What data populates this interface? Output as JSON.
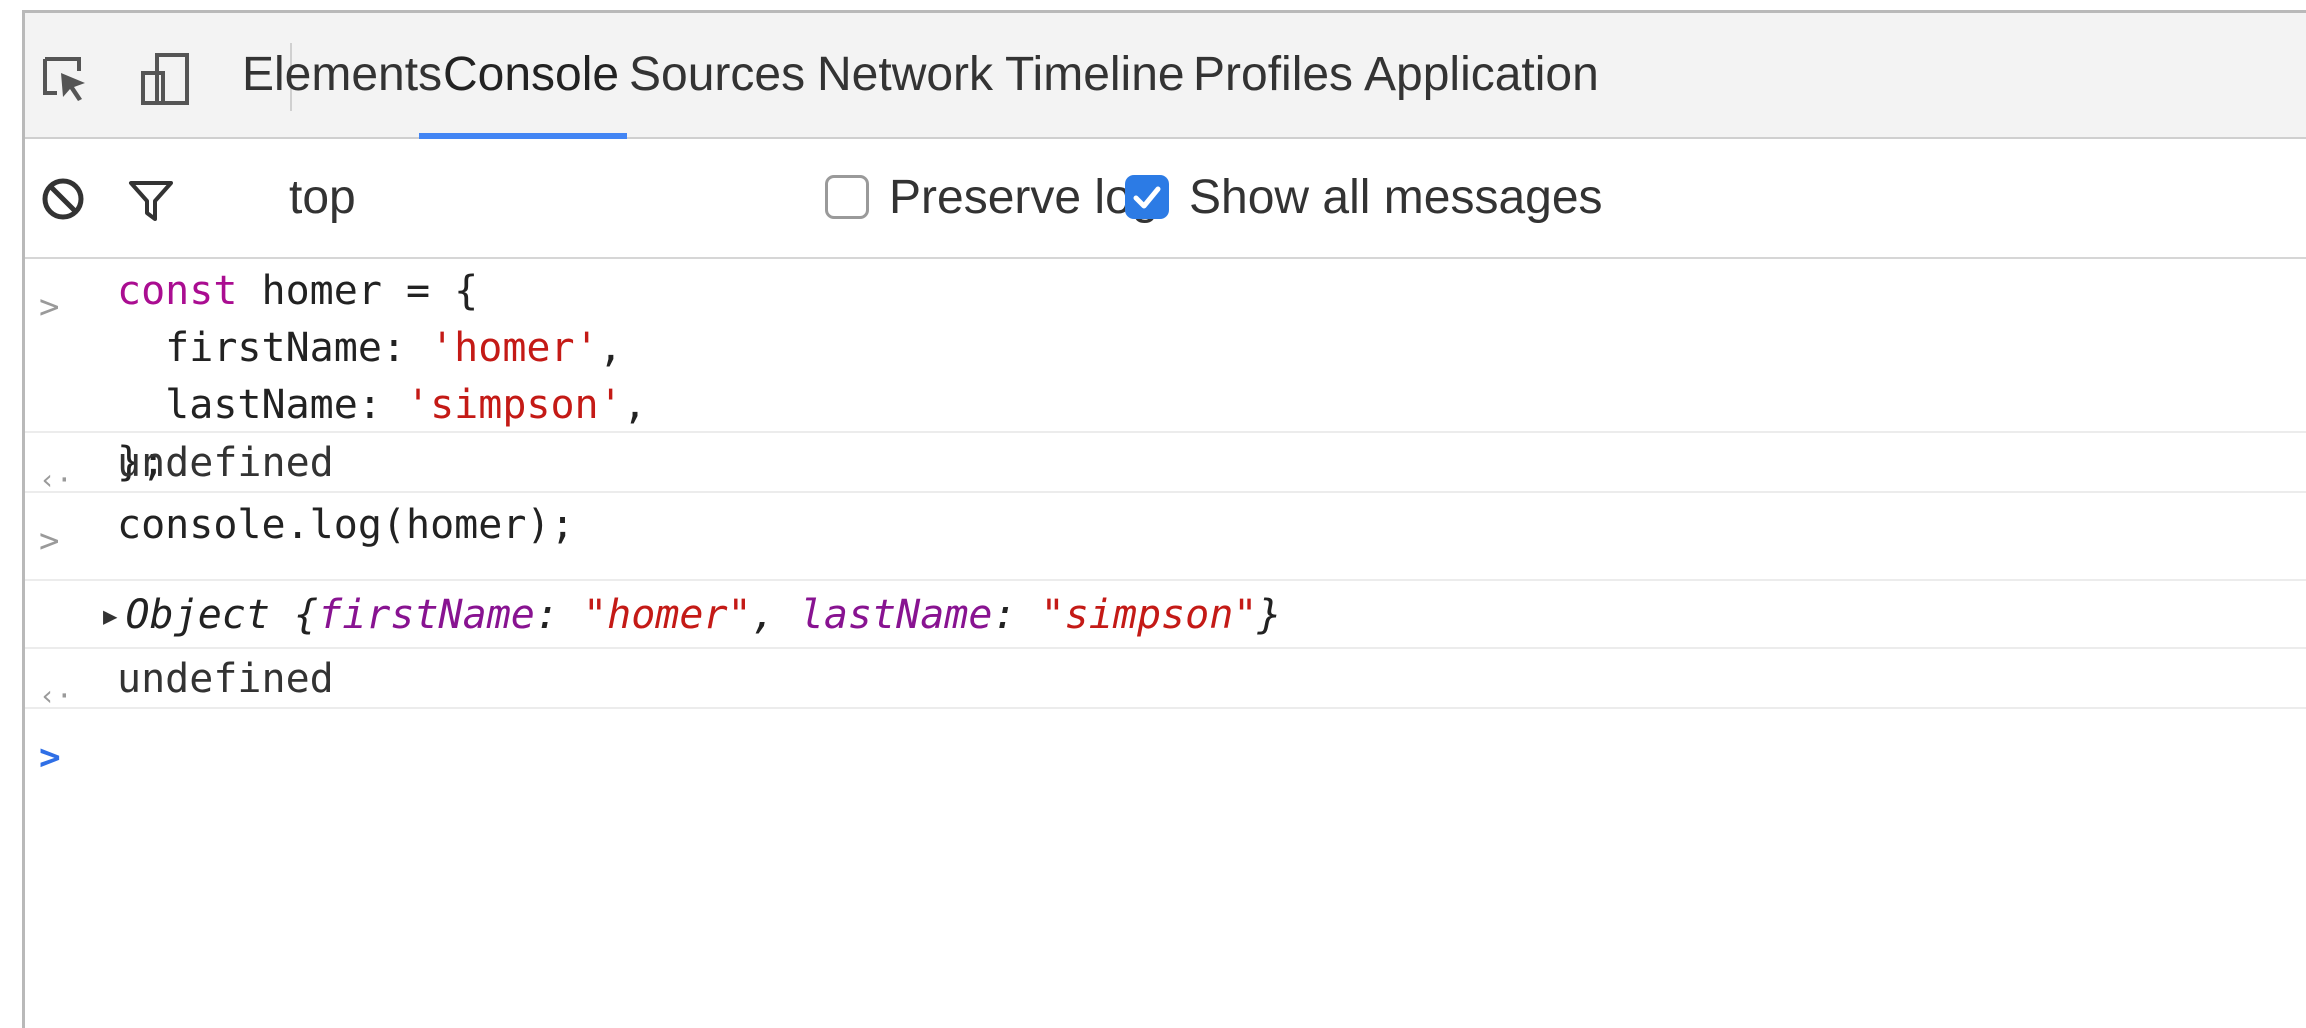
{
  "toolbar_tabs": {
    "tabs": [
      "Elements",
      "Console",
      "Sources",
      "Network",
      "Timeline",
      "Profiles",
      "Application"
    ],
    "active_tab": "Console"
  },
  "console_toolbar": {
    "context": "top",
    "preserve_log_label": "Preserve log",
    "preserve_log_checked": false,
    "show_all_label": "Show all messages",
    "show_all_checked": true
  },
  "console": {
    "entries": [
      {
        "type": "input",
        "lines": [
          {
            "parts": [
              {
                "t": "const",
                "c": "kw"
              },
              {
                "t": " homer = {",
                "c": ""
              }
            ]
          },
          {
            "parts": [
              {
                "t": "  firstName: ",
                "c": ""
              },
              {
                "t": "'homer'",
                "c": "str"
              },
              {
                "t": ",",
                "c": ""
              }
            ]
          },
          {
            "parts": [
              {
                "t": "  lastName: ",
                "c": ""
              },
              {
                "t": "'simpson'",
                "c": "str"
              },
              {
                "t": ",",
                "c": ""
              }
            ]
          },
          {
            "parts": [
              {
                "t": "};",
                "c": ""
              }
            ]
          }
        ]
      },
      {
        "type": "result",
        "text": "undefined"
      },
      {
        "type": "input",
        "lines": [
          {
            "parts": [
              {
                "t": "console.log(homer);",
                "c": ""
              }
            ]
          }
        ]
      },
      {
        "type": "log",
        "prefix": "Object",
        "parts": [
          {
            "t": " {",
            "c": ""
          },
          {
            "t": "firstName",
            "c": "key"
          },
          {
            "t": ": ",
            "c": ""
          },
          {
            "t": "\"homer\"",
            "c": "str"
          },
          {
            "t": ", ",
            "c": ""
          },
          {
            "t": "lastName",
            "c": "key"
          },
          {
            "t": ": ",
            "c": ""
          },
          {
            "t": "\"simpson\"",
            "c": "str"
          },
          {
            "t": "}",
            "c": ""
          }
        ]
      },
      {
        "type": "result",
        "text": "undefined"
      }
    ],
    "prompt_symbol": ">",
    "result_symbol": "‹·"
  },
  "icons": {
    "inspect": "inspect-element-icon",
    "device": "device-toolbar-icon",
    "clear": "clear-console-icon",
    "filter": "filter-icon",
    "dropdown": "dropdown-arrow-icon",
    "expand": "expand-triangle-icon"
  },
  "colors": {
    "keyword": "#aa0d91",
    "string": "#c41a16",
    "property": "#881391",
    "active_tab_underline": "#4285f4",
    "checkbox_checked": "#2c7be5"
  }
}
